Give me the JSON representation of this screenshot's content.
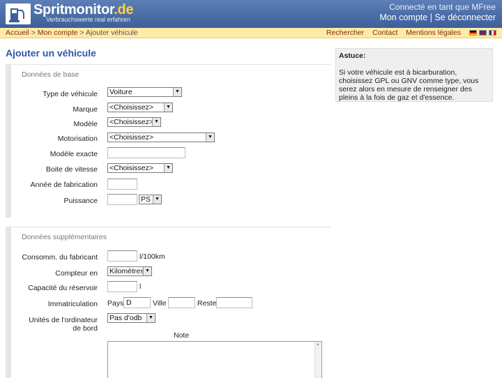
{
  "header": {
    "logo_main": "Spritmonitor",
    "logo_tld": ".de",
    "logo_tagline": "Verbrauchswerte real erfahren",
    "logged_in_text": "Connecté en tant que MFree",
    "my_account": "Mon compte",
    "separator": "|",
    "logout": "Se déconnecter"
  },
  "breadcrumb": {
    "home": "Accueil",
    "sep1": ">",
    "account": "Mon compte",
    "sep2": ">",
    "current": "Ajouter véhicule"
  },
  "nav": {
    "search": "Rechercher",
    "contact": "Contact",
    "legal": "Mentions légales"
  },
  "page_title": "Ajouter un véhicule",
  "basic": {
    "title": "Données de base",
    "vehicle_type_label": "Type de véhicule",
    "vehicle_type_value": "Voiture",
    "brand_label": "Marque",
    "brand_value": "<Choisissez>",
    "model_label": "Modèle",
    "model_value": "<Choisissez>",
    "engine_label": "Motorisation",
    "engine_value": "<Choisissez>",
    "exact_model_label": "Modèle exacte",
    "gearbox_label": "Boite de vitesse",
    "gearbox_value": "<Choisissez>",
    "year_label": "Année de fabrication",
    "power_label": "Puissance",
    "power_unit": "PS"
  },
  "extra": {
    "title": "Données supplémentaires",
    "consumption_label": "Consomm. du fabricant",
    "consumption_unit": "l/100km",
    "counter_label": "Compteur en",
    "counter_value": "Kilomètres",
    "tank_label": "Capacité du réservoir",
    "tank_unit": "l",
    "registration_label": "Immatriculation",
    "country_label": "Pays",
    "country_value": "D",
    "city_label": "Ville",
    "rest_label": "Reste",
    "board_units_label_1": "Unités de l'ordinateur",
    "board_units_label_2": "de bord",
    "board_units_value": "Pas d'odb",
    "note_label": "Note"
  },
  "tip": {
    "title": "Astuce:",
    "text": "Si votre véhicule est à bicarburation, choisissez GPL ou GNV comme type, vous serez alors en mesure de renseigner des pleins à la fois de gaz et d'essence."
  }
}
